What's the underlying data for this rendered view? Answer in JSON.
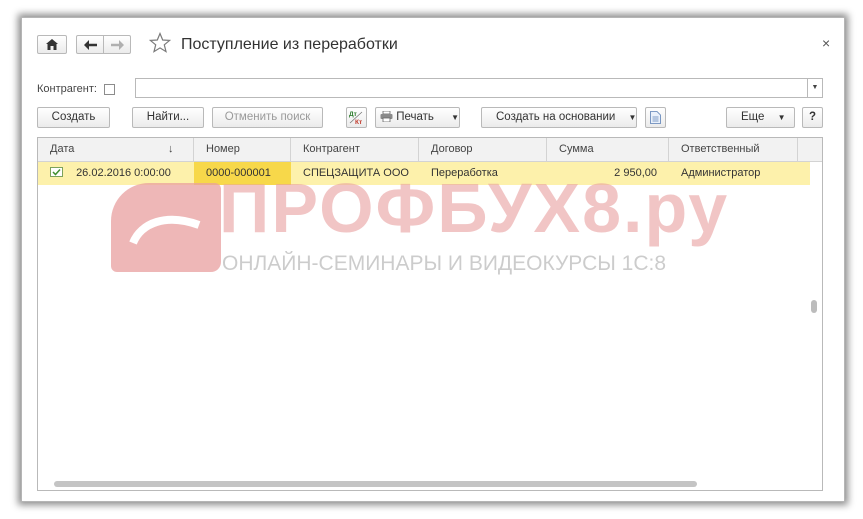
{
  "window": {
    "title": "Поступление из переработки",
    "close_glyph": "×"
  },
  "nav": {
    "home_icon": "home-icon",
    "back_icon": "arrow-left-icon",
    "forward_icon": "arrow-right-icon",
    "favorite_icon": "star-icon"
  },
  "filter": {
    "label": "Контрагент:",
    "checked": false,
    "value": ""
  },
  "toolbar": {
    "create": "Создать",
    "find": "Найти...",
    "cancel_search": "Отменить поиск",
    "dt_kt_top": "Дт",
    "dt_kt_bottom": "Кт",
    "print": "Печать",
    "create_based_on": "Создать на основании",
    "more": "Еще",
    "help": "?"
  },
  "table": {
    "columns": [
      "Дата",
      "Номер",
      "Контрагент",
      "Договор",
      "Сумма",
      "Ответственный"
    ],
    "sort_indicator": "↓",
    "rows": [
      {
        "date": "26.02.2016 0:00:00",
        "number": "0000-000001",
        "counterparty": "СПЕЦЗАЩИТА ООО",
        "contract": "Переработка",
        "sum": "2 950,00",
        "responsible": "Администратор"
      }
    ]
  },
  "watermark": {
    "brand": "ПРОФБУХ8.ру",
    "tagline": "ОНЛАЙН-СЕМИНАРЫ И ВИДЕОКУРСЫ 1С:8"
  },
  "colors": {
    "row_highlight": "#fdf1ab",
    "selected_cell": "#f7d84a",
    "watermark": "#e9a0a0"
  }
}
